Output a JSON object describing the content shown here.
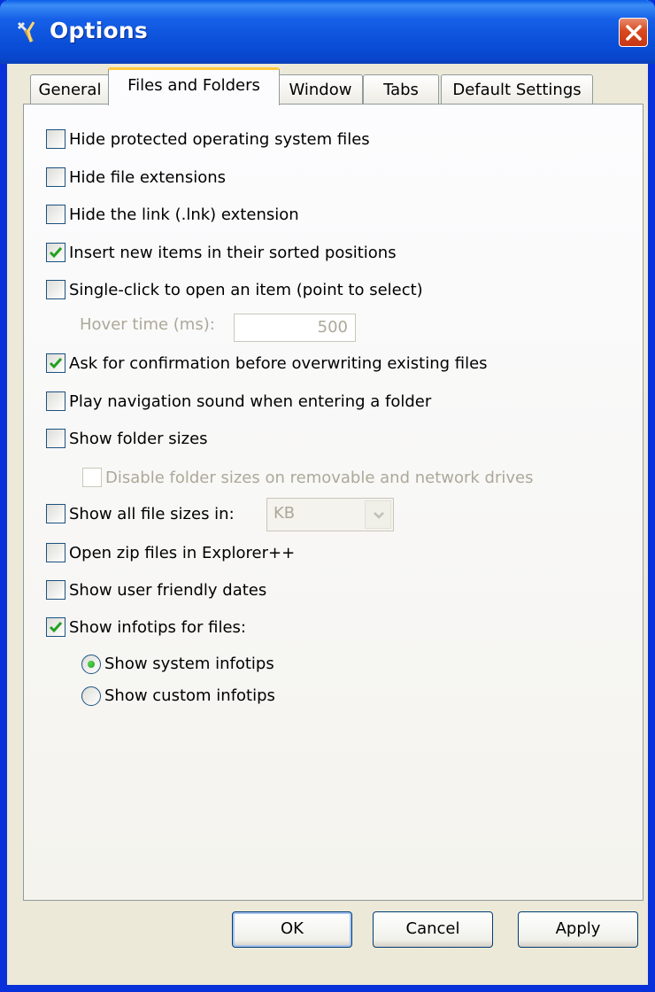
{
  "window": {
    "title": "Options",
    "app_icon": "tools-icon",
    "close_icon": "close-icon"
  },
  "tabs": [
    {
      "label": "General",
      "active": false
    },
    {
      "label": "Files and Folders",
      "active": true
    },
    {
      "label": "Window",
      "active": false
    },
    {
      "label": "Tabs",
      "active": false
    },
    {
      "label": "Default Settings",
      "active": false
    }
  ],
  "options": {
    "hide_protected": {
      "label": "Hide protected operating system files",
      "checked": false
    },
    "hide_extensions": {
      "label": "Hide file extensions",
      "checked": false
    },
    "hide_lnk": {
      "label": "Hide the link (.lnk) extension",
      "checked": false
    },
    "insert_sorted": {
      "label": "Insert new items in their sorted positions",
      "checked": true
    },
    "single_click": {
      "label": "Single-click to open an item (point to select)",
      "checked": false
    },
    "hover_time": {
      "label": "Hover time (ms):",
      "value": "500",
      "enabled": false
    },
    "ask_confirm": {
      "label": "Ask for confirmation before overwriting existing files",
      "checked": true
    },
    "nav_sound": {
      "label": "Play navigation sound when entering a folder",
      "checked": false
    },
    "folder_sizes": {
      "label": "Show folder sizes",
      "checked": false
    },
    "disable_folder_sizes": {
      "label": "Disable folder sizes on removable and network drives",
      "checked": false,
      "enabled": false
    },
    "all_file_sizes": {
      "label": "Show all file sizes in:",
      "checked": false,
      "unit": "KB",
      "enabled": false
    },
    "open_zip": {
      "label": "Open zip files in Explorer++",
      "checked": false
    },
    "friendly_dates": {
      "label": "Show user friendly dates",
      "checked": false
    },
    "infotips": {
      "label": "Show infotips for files:",
      "checked": true
    },
    "infotip_system": {
      "label": "Show system infotips",
      "selected": true
    },
    "infotip_custom": {
      "label": "Show custom infotips",
      "selected": false
    }
  },
  "buttons": {
    "ok": "OK",
    "cancel": "Cancel",
    "apply": "Apply"
  },
  "colors": {
    "titlebar": "#0A4ED8",
    "dialog_bg": "#ECE9D8",
    "check": "#21A121",
    "tab_highlight": "#FFC83C",
    "close": "#D8491E"
  }
}
